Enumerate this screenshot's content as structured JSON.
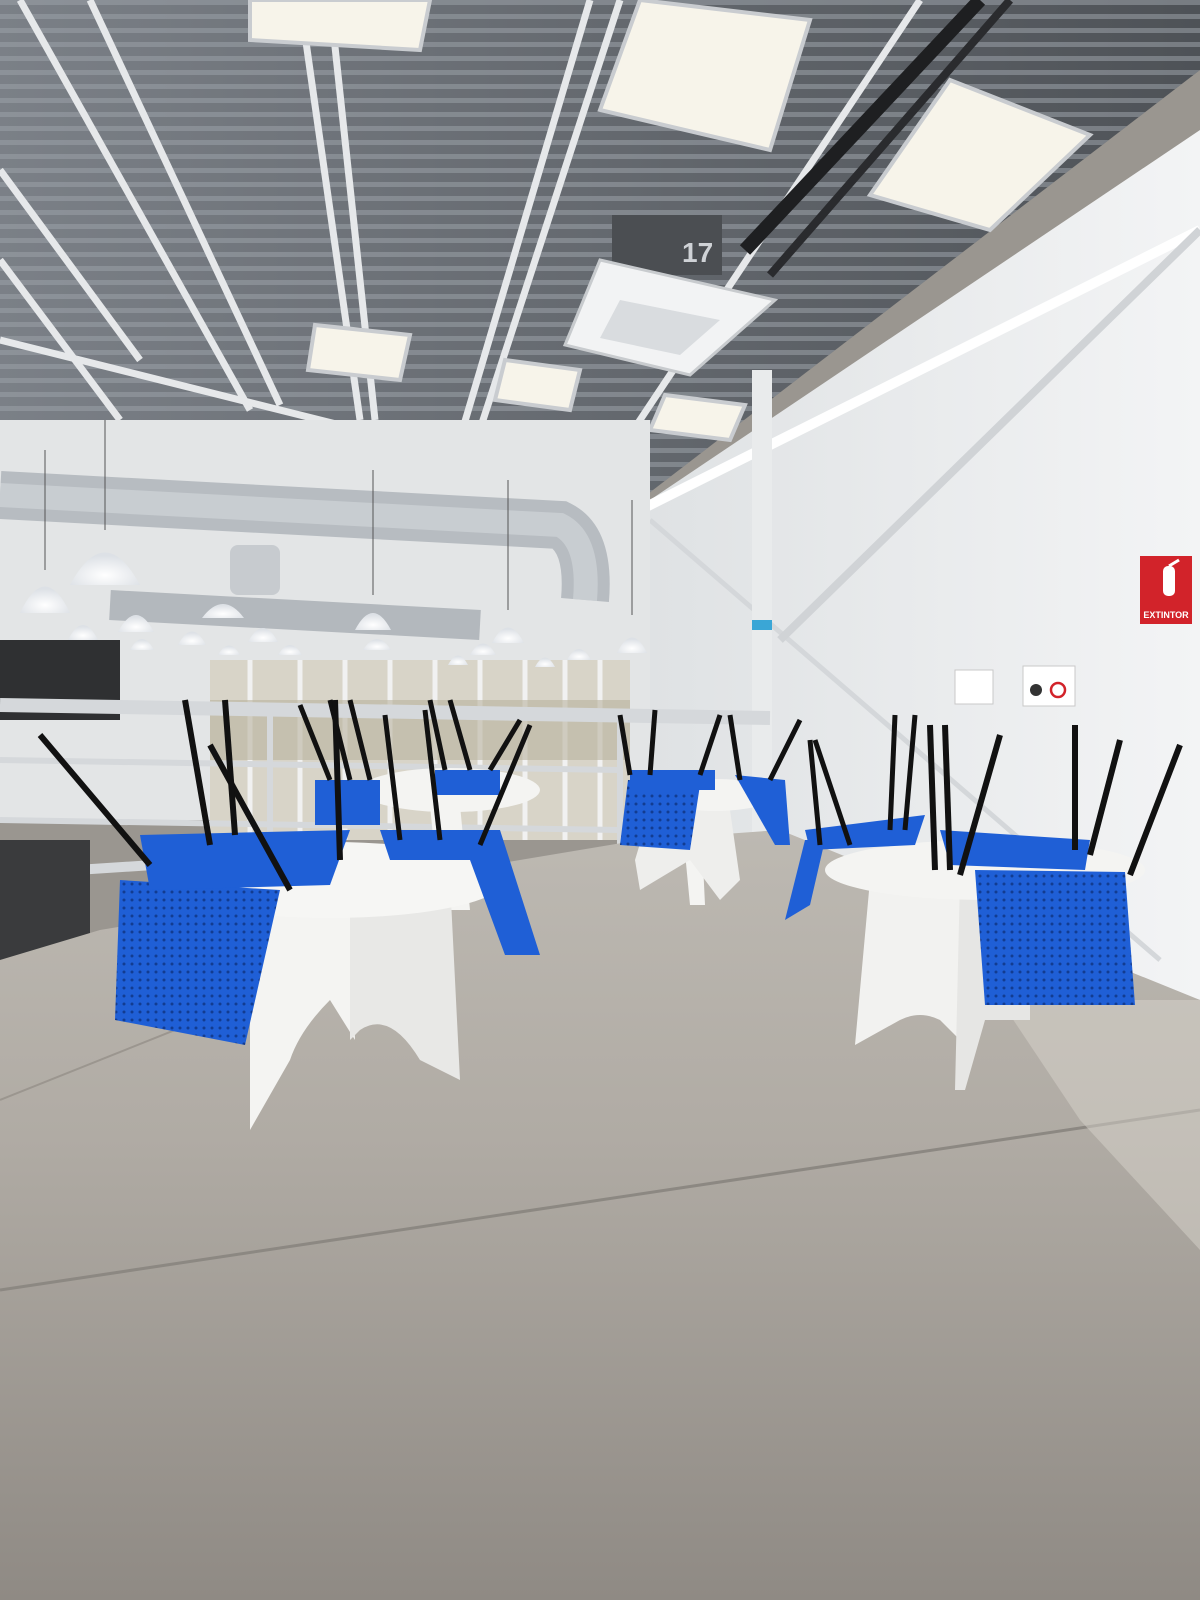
{
  "scene": {
    "description_label": "",
    "ceiling_unit_number": "17",
    "extinguisher_sign": "EXTINTOR"
  },
  "colors": {
    "ceiling": "#5d6166",
    "wall": "#eceeef",
    "floor": "#a9a59f",
    "chair_blue": "#1f5fd6",
    "table_white": "#f4f4f2",
    "sign_red": "#d2232a"
  },
  "icons": [
    "fire-extinguisher-icon",
    "no-smoking-icon"
  ]
}
